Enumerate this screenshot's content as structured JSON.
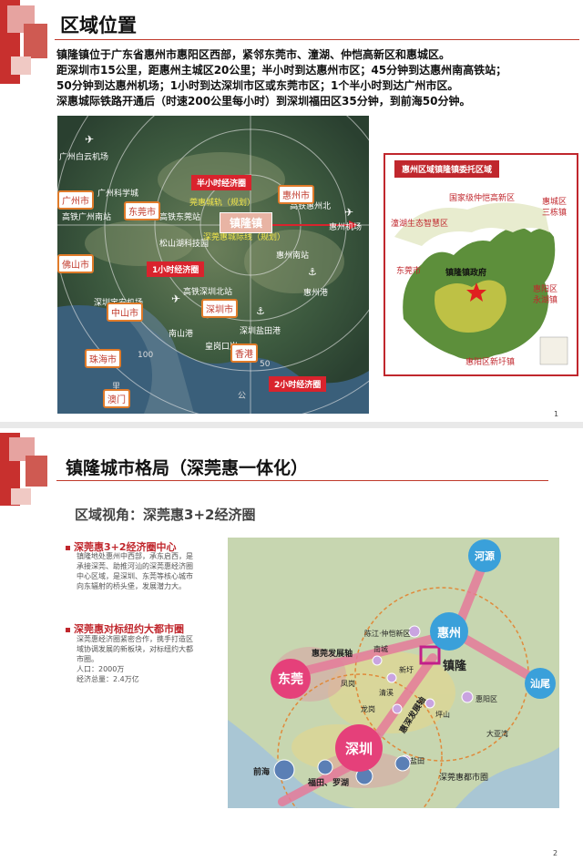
{
  "slide1": {
    "title": "区域位置",
    "intro_lines": [
      "镇隆镇位于广东省惠州市惠阳区西部，紧邻东莞市、潼湖、仲恺高新区和惠城区。",
      "距深圳市15公里，距惠州主城区20公里；半小时到达惠州市区；45分钟到达惠州南高铁站；",
      "50分钟到达惠州机场；1小时到达深圳市区或东莞市区；1个半小时到达广州市区。",
      "深惠城际铁路开通后（时速200公里每小时）到深圳福田区35分钟，到前海50分钟。"
    ],
    "map": {
      "cities": {
        "guangzhou": "广州市",
        "dongguan": "东莞市",
        "foshan": "佛山市",
        "huizhou": "惠州市",
        "zhongshan": "中山市",
        "shenzhen": "深圳市",
        "zhuhai": "珠海市",
        "hongkong": "香港",
        "macau": "澳门"
      },
      "center": "镇隆镇",
      "rings": {
        "half_hour": "半小时经济圈",
        "one_hour": "1小时经济圈",
        "two_hour": "2小时经济圈"
      },
      "places": {
        "baiyun": "广州白云机场",
        "science": "广州科学城",
        "gaotie_gz": "高铁广州南站",
        "gaotie_dg": "高铁东莞站",
        "songshan": "松山湖科技园",
        "huinanzhan": "惠州南站",
        "huizhouport": "惠州港",
        "shenzhen_north": "高铁深圳北站",
        "baoan": "深圳宝安机场",
        "nanshan": "南山港",
        "yantian": "深圳盐田港",
        "xiuzhuang": "皇岗口岸",
        "gaotie_hz": "高铁惠州北",
        "hz_airport": "惠州机场",
        "yellow1": "莞惠城轨（规划）",
        "yellow2": "深莞惠城际线（规划）",
        "r100": "100",
        "r50": "50",
        "gong": "公",
        "li": "里"
      }
    },
    "panel": {
      "header": "惠州区域镇隆镇委托区域",
      "labels": {
        "zhongkai": "国家级仲恺高新区",
        "huicheng": "惠城区",
        "sandongzhen": "三栋镇",
        "tonghu": "潼湖生态智慧区",
        "dongguan": "东莞市",
        "govt": "镇隆镇政府",
        "yonghu": "惠阳区",
        "yonghu2": "永湖镇",
        "xinxu": "惠阳区新圩镇"
      }
    },
    "page": "1"
  },
  "slide2": {
    "title": "镇隆城市格局（深莞惠一体化）",
    "subtitle": "区域视角：深莞惠3+2经济圈",
    "bullets": [
      {
        "heading": "深莞惠3+2经济圈中心",
        "lines": [
          "镇隆地处惠州中西部，承东启西，是",
          "承接深莞、助推河汕的深莞惠经济圈",
          "中心区域，是深圳、东莞等核心城市",
          "向东辐射的桥头堡，发展潜力大。"
        ]
      },
      {
        "heading": "深莞惠对标纽约大都市圈",
        "lines": [
          "深莞惠经济圈紧密合作，携手打造区",
          "域协调发展的新板块，对标纽约大都",
          "市圈。",
          "人口：2000万",
          "经济总量：2.4万亿"
        ]
      }
    ],
    "map": {
      "heyuan": "河源",
      "huizhou": "惠州",
      "dongguan": "东莞",
      "shanwei": "汕尾",
      "shenzhen": "深圳",
      "zhenlong": "镇隆",
      "axis1": "惠莞发展轴",
      "axis2": "惠深发展轴",
      "chenjiang": "陈江·仲恺新区",
      "nancheng": "南城",
      "fenggang": "凤岗",
      "qinghu": "清溪",
      "xintang": "新圩",
      "longgang": "龙岗",
      "pingshan": "坪山",
      "huiyang": "惠阳区",
      "daya": "大亚湾",
      "yantian": "盐田",
      "qianhai": "前海",
      "futian": "福田、罗湖",
      "metro": "深莞惠都市圈"
    },
    "page": "2"
  }
}
